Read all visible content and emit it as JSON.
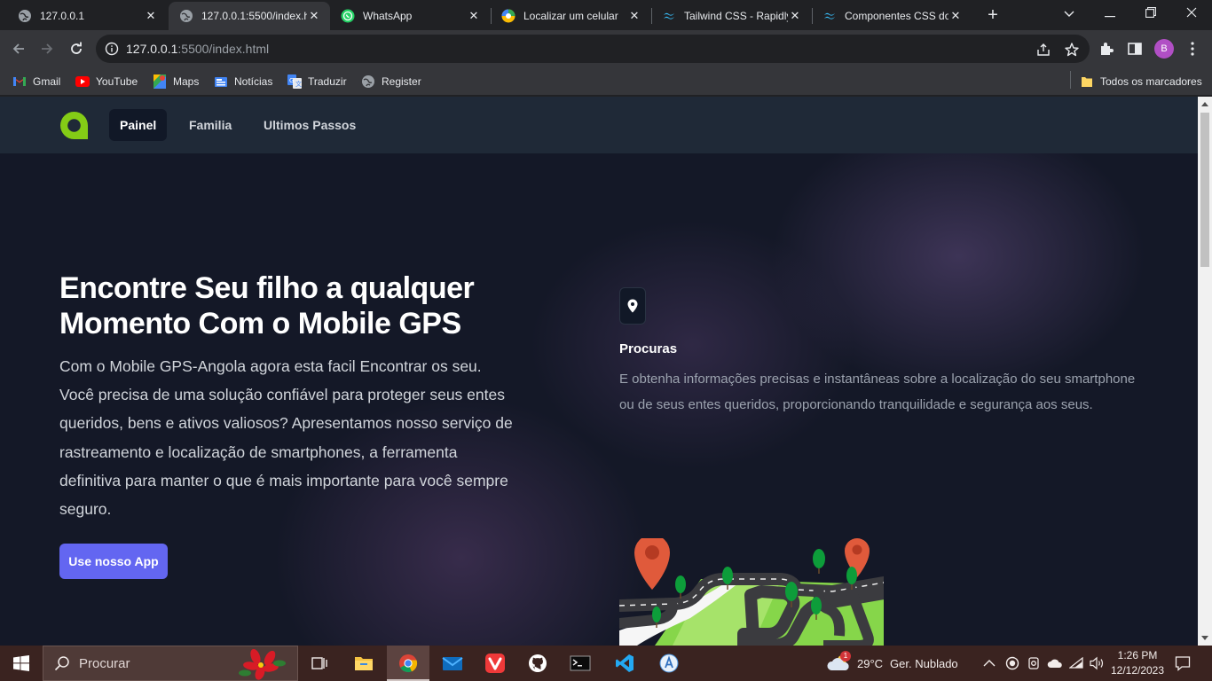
{
  "browser": {
    "tabs": [
      {
        "title": "127.0.0.1",
        "icon": "globe-icon",
        "active": false
      },
      {
        "title": "127.0.0.1:5500/index.h",
        "icon": "globe-icon",
        "active": true
      },
      {
        "title": "WhatsApp",
        "icon": "whatsapp-icon",
        "active": false
      },
      {
        "title": "Localizar um celular",
        "icon": "google-find-icon",
        "active": false
      },
      {
        "title": "Tailwind CSS - Rapidly",
        "icon": "tailwind-icon",
        "active": false
      },
      {
        "title": "Componentes CSS do",
        "icon": "tailwind-icon",
        "active": false
      }
    ],
    "url_host": "127.0.0.1",
    "url_path": ":5500/index.html",
    "profile_initial": "B",
    "bookmarks": [
      {
        "label": "Gmail",
        "icon": "gmail-icon"
      },
      {
        "label": "YouTube",
        "icon": "youtube-icon"
      },
      {
        "label": "Maps",
        "icon": "maps-icon"
      },
      {
        "label": "Notícias",
        "icon": "news-icon"
      },
      {
        "label": "Traduzir",
        "icon": "translate-icon"
      },
      {
        "label": "Register",
        "icon": "globe-icon"
      }
    ],
    "all_bookmarks_label": "Todos os marcadores"
  },
  "site": {
    "nav": [
      {
        "label": "Painel",
        "active": true
      },
      {
        "label": "Familia",
        "active": false
      },
      {
        "label": "Ultimos Passos",
        "active": false
      }
    ],
    "hero": {
      "title": "Encontre Seu filho a qualquer Momento Com o Mobile GPS",
      "text": "Com o Mobile GPS-Angola agora esta facil Encontrar os seu. Você precisa de uma solução confiável para proteger seus entes queridos, bens e ativos valiosos? Apresentamos nosso serviço de rastreamento e localização de smartphones, a ferramenta definitiva para manter o que é mais importante para você sempre seguro.",
      "cta": "Use nosso App"
    },
    "feature": {
      "icon": "map-pin-icon",
      "title": "Procuras",
      "text": "E obtenha informações precisas e instantâneas sobre a localização do seu smartphone ou de seus entes queridos, proporcionando tranquilidade e segurança aos seus."
    },
    "colors": {
      "accent": "#6366f1",
      "logo": "#84cc16",
      "nav_bg": "#1f2937",
      "page_bg": "#141827"
    }
  },
  "taskbar": {
    "search_placeholder": "Procurar",
    "apps": [
      "task-view-icon",
      "file-explorer-icon",
      "chrome-icon",
      "mail-icon",
      "vivaldi-icon",
      "github-icon",
      "terminal-icon",
      "vscode-icon",
      "app-installer-icon"
    ],
    "weather_temp": "29°C",
    "weather_desc": "Ger. Nublado",
    "weather_badge": "1",
    "time": "1:26 PM",
    "date": "12/12/2023"
  }
}
